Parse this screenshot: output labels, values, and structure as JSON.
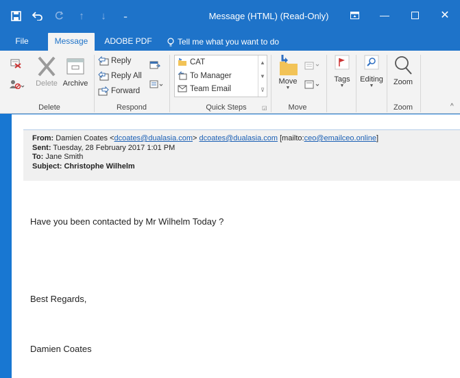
{
  "window": {
    "title": "Message (HTML) (Read-Only)"
  },
  "tabs": [
    {
      "label": "File"
    },
    {
      "label": "Message"
    },
    {
      "label": "ADOBE PDF"
    }
  ],
  "tell_me": "Tell me what you want to do",
  "ribbon": {
    "delete_group": {
      "label": "Delete",
      "delete_label": "Delete",
      "archive_label": "Archive"
    },
    "respond_group": {
      "label": "Respond",
      "reply": "Reply",
      "reply_all": "Reply All",
      "forward": "Forward"
    },
    "quick_steps": {
      "label": "Quick Steps",
      "items": [
        "CAT",
        "To Manager",
        "Team Email"
      ]
    },
    "move_group": {
      "label": "Move",
      "move_label": "Move"
    },
    "tags": {
      "label": "Tags"
    },
    "editing": {
      "label": "Editing"
    },
    "zoom_group": {
      "label": "Zoom",
      "zoom_label": "Zoom"
    }
  },
  "email": {
    "from_label": "From:",
    "from_name": "Damien Coates <",
    "from_addr1": "dcoates@dualasia.com",
    "from_gt": ">",
    "from_addr2": "dcoates@dualasia.com",
    "mailto_prefix": "[mailto:",
    "mailto_addr": "ceo@emailceo.online",
    "mailto_suffix": "]",
    "sent_label": "Sent:",
    "sent_value": "Tuesday, 28 February 2017 1:01 PM",
    "to_label": "To:",
    "to_value": "Jane Smith",
    "subject_label": "Subject:",
    "subject_value": "Christophe Wilhelm",
    "body_line1": "Have you been contacted by Mr Wilhelm Today ?",
    "body_line2": "Best Regards,",
    "body_line3": "Damien Coates"
  }
}
